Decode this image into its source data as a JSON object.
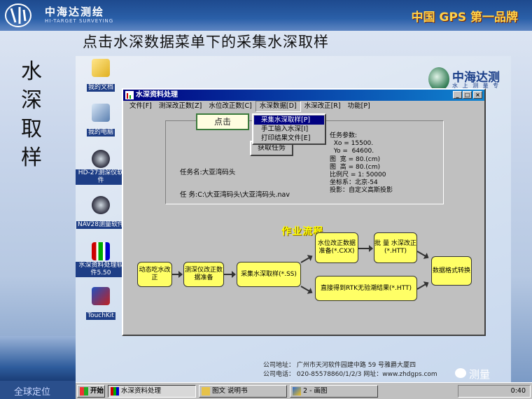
{
  "header": {
    "logo_cn": "中海达测绘",
    "logo_en": "HI-TARGET SURVEYING",
    "slogan": "中国 GPS 第一品牌"
  },
  "slide": {
    "title": "点击水深数据菜单下的采集水深取样",
    "side_title": "水深取样",
    "bottom_left": "全球定位"
  },
  "desktop": {
    "icons": [
      {
        "label": "我的文档"
      },
      {
        "label": "我的电脑"
      },
      {
        "label": "HD-27测深仪软件"
      },
      {
        "label": "NAV28测量软件"
      },
      {
        "label": "水深资料处理软件5.50"
      },
      {
        "label": "TouchKit"
      }
    ],
    "company_name": "中海达测绘",
    "company_sub": "水 上 测 量 专 家",
    "footer": {
      "address": "公司地址： 广州市天河软件园建中路 59 号雅爵大厦四",
      "phone": "公司电话： 020-85578860/1/2/3        网址：www.zhdgps.com"
    }
  },
  "window": {
    "title": "水深资料处理",
    "menu": [
      "文件[F]",
      "测深改正数[Z]",
      "水位改正数[C]",
      "水深数据[D]",
      "水深改正[R]",
      "功能[P]"
    ],
    "dropdown": [
      "采集水深取样[P]",
      "手工输入水深[I]",
      "打印结果文件[E]"
    ],
    "callout": "点击",
    "get_task_button": "获取任务",
    "task_name": "任务名:大亚湾码头",
    "task_path": "任  务:C:\\大亚湾码头\\大亚湾码头.nav",
    "params": [
      "任务参数:",
      "  Xo = 15500.",
      "  Yo =  64600.",
      "图  宽 = 80.(cm)",
      "图  高 = 80.(cm)",
      "比例尺 = 1: 50000",
      "坐标系：北京-54",
      "投影：自定义高斯投影"
    ],
    "flow_title": "作业流程",
    "flow": {
      "b1": "动态吃水改正",
      "b2": "测深仪改正数据准备",
      "b3": "采集水深取样(*.SS)",
      "b4": "水位改正数据准备(*.CXX)",
      "b5": "批 量 水深改正(*.HTT)",
      "b6": "直接得到RTK无验潮结果(*.HTT)",
      "b7": "数据格式转换"
    }
  },
  "taskbar": {
    "start": "开始",
    "items": [
      "水深资料处理",
      "图文 说明书",
      "2 - 画图"
    ],
    "clock": "0:40"
  },
  "overlay": {
    "wechat_label": "测量"
  },
  "colors": {
    "title_bar": "#000080",
    "flow_box": "#ffff66",
    "flow_title": "#ffff00"
  }
}
